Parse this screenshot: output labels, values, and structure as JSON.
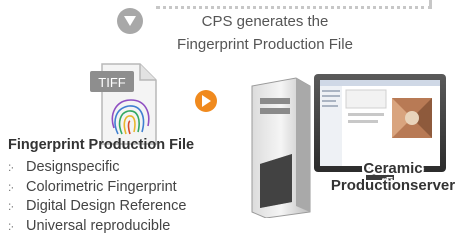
{
  "step": {
    "line1": "CPS generates the",
    "line2": "Fingerprint Production File"
  },
  "tiff_icon": {
    "label": "TIFF"
  },
  "file": {
    "title": "Fingerprint Production File",
    "features": [
      "Designspecific",
      "Colorimetric Fingerprint",
      "Digital Design Reference",
      "Universal reproducible"
    ]
  },
  "server": {
    "line1": "Ceramic",
    "line2": "Productionserver"
  },
  "colors": {
    "accent_orange": "#f08a1e",
    "step_gray": "#a8a8a8",
    "text": "#333333"
  }
}
